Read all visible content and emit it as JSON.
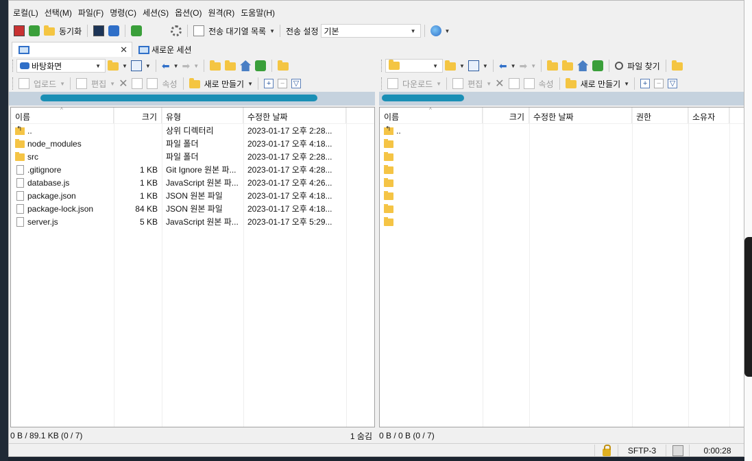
{
  "menu": [
    "로컬(L)",
    "선택(M)",
    "파일(F)",
    "명령(C)",
    "세션(S)",
    "옵션(O)",
    "원격(R)",
    "도움말(H)"
  ],
  "toolbar": {
    "sync_label": "동기화",
    "queue_label": "전송 대기열 목록",
    "transfer_settings_label": "전송 설정",
    "transfer_mode_value": "기본"
  },
  "tabs": {
    "new_session_label": "새로운 세션"
  },
  "local": {
    "location": "바탕화면",
    "upload_label": "업로드",
    "edit_label": "편집",
    "properties_label": "속성",
    "new_label": "새로 만들기",
    "columns": [
      "이름",
      "크기",
      "유형",
      "수정한 날짜"
    ],
    "files": [
      {
        "name": "..",
        "size": "",
        "type": "상위 디렉터리",
        "modified": "2023-01-17  오후 2:28...",
        "icon": "up-folder-icon"
      },
      {
        "name": "node_modules",
        "size": "",
        "type": "파일 폴더",
        "modified": "2023-01-17  오후 4:18...",
        "icon": "folder-icon"
      },
      {
        "name": "src",
        "size": "",
        "type": "파일 폴더",
        "modified": "2023-01-17  오후 2:28...",
        "icon": "folder-icon"
      },
      {
        "name": ".gitignore",
        "size": "1 KB",
        "type": "Git Ignore 원본 파...",
        "modified": "2023-01-17  오후 4:28...",
        "icon": "file-icon"
      },
      {
        "name": "database.js",
        "size": "1 KB",
        "type": "JavaScript 원본 파...",
        "modified": "2023-01-17  오후 4:26...",
        "icon": "file-icon"
      },
      {
        "name": "package.json",
        "size": "1 KB",
        "type": "JSON 원본 파일",
        "modified": "2023-01-17  오후 4:18...",
        "icon": "file-icon"
      },
      {
        "name": "package-lock.json",
        "size": "84 KB",
        "type": "JSON 원본 파일",
        "modified": "2023-01-17  오후 4:18...",
        "icon": "file-icon"
      },
      {
        "name": "server.js",
        "size": "5 KB",
        "type": "JavaScript 원본 파...",
        "modified": "2023-01-17  오후 5:29...",
        "icon": "file-icon"
      }
    ],
    "status": "0 B / 89.1 KB (0 / 7)",
    "hidden": "1 숨김"
  },
  "remote": {
    "download_label": "다운로드",
    "edit_label": "편집",
    "properties_label": "속성",
    "new_label": "새로 만들기",
    "find_label": "파일 찾기",
    "columns": [
      "이름",
      "크기",
      "수정한 날짜",
      "권한",
      "소유자"
    ],
    "rows": [
      {
        "name": "..",
        "icon": "up-folder-icon"
      },
      {
        "name": "",
        "icon": "folder-icon"
      },
      {
        "name": "",
        "icon": "folder-icon"
      },
      {
        "name": "",
        "icon": "folder-icon"
      },
      {
        "name": "",
        "icon": "folder-icon"
      },
      {
        "name": "",
        "icon": "folder-icon"
      },
      {
        "name": "",
        "icon": "folder-icon"
      },
      {
        "name": "",
        "icon": "folder-icon"
      }
    ],
    "status": "0 B / 0 B (0 / 7)"
  },
  "statusbar": {
    "protocol": "SFTP-3",
    "elapsed": "0:00:28"
  },
  "colors": {
    "path_bar": "#c5d2de",
    "redaction": "#1a8fb5",
    "folder": "#f5c445"
  }
}
